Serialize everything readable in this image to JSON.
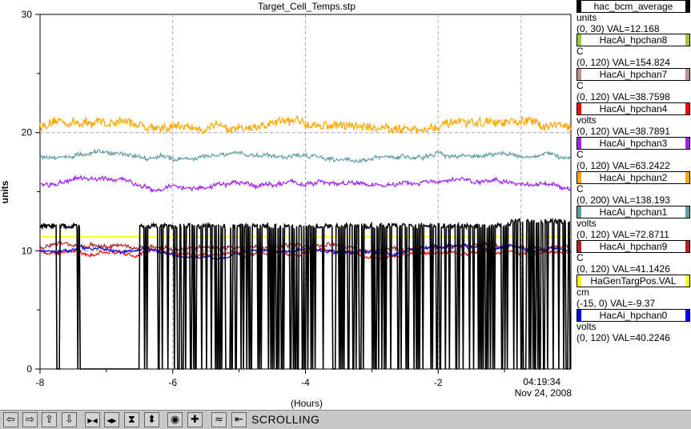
{
  "chart_data": {
    "type": "line",
    "title": "Target_Cell_Temps.stp",
    "xlabel": "(Hours)",
    "ylabel": "units",
    "xlim": [
      -8,
      0
    ],
    "ylim": [
      0,
      30
    ],
    "x_ticks": [
      "-8",
      "-6",
      "-4",
      "-2"
    ],
    "y_ticks": [
      "0",
      "10",
      "20",
      "30"
    ],
    "grid": true,
    "time_label": "04:19:34",
    "date_label": "Nov 24, 2008",
    "series": [
      {
        "name": "HacAi_hpchan2",
        "color": "#ffa500",
        "base": 20.6,
        "noise": 0.35,
        "kind": "noisy"
      },
      {
        "name": "HacAi_hpchan1",
        "color": "#5f9ea0",
        "base": 18.0,
        "noise": 0.15,
        "kind": "noisy"
      },
      {
        "name": "HacAi_hpchan3",
        "color": "#a020f0",
        "base": 15.6,
        "noise": 0.15,
        "kind": "noisy"
      },
      {
        "name": "HaGenTargPos.VAL",
        "color": "#ffff00",
        "base": 11.2,
        "noise": 0.0,
        "kind": "flat"
      },
      {
        "name": "HacAi_hpchan9",
        "color": "#b22222",
        "base": 10.3,
        "noise": 0.15,
        "kind": "noisy"
      },
      {
        "name": "HacAi_hpchan4",
        "color": "#ff0000",
        "base": 9.8,
        "noise": 0.1,
        "kind": "noisy"
      },
      {
        "name": "HacAi_hpchan0",
        "color": "#0000ff",
        "base": 10.0,
        "noise": 0.1,
        "kind": "noisy"
      },
      {
        "name": "hac_bcm_average",
        "color": "#000000",
        "base": 12.1,
        "noise": 0.2,
        "kind": "bcm"
      }
    ]
  },
  "legend": [
    {
      "name": "hac_bcm_average",
      "color": "#000000",
      "unit": "units",
      "value": "(0, 30) VAL=12.168"
    },
    {
      "name": "HacAi_hpchan8",
      "color": "#9acd32",
      "unit": "C",
      "value": "(0, 120) VAL=154.824"
    },
    {
      "name": "HacAi_hpchan7",
      "color": "#bc8f8f",
      "unit": "C",
      "value": "(0, 120) VAL=38.7598"
    },
    {
      "name": "HacAi_hpchan4",
      "color": "#ff0000",
      "unit": "volts",
      "value": "(0, 120) VAL=38.7891"
    },
    {
      "name": "HacAi_hpchan3",
      "color": "#a020f0",
      "unit": "C",
      "value": "(0, 120) VAL=63.2422"
    },
    {
      "name": "HacAi_hpchan2",
      "color": "#ffa500",
      "unit": "C",
      "value": "(0, 200) VAL=138.193"
    },
    {
      "name": "HacAi_hpchan1",
      "color": "#5f9ea0",
      "unit": "volts",
      "value": "(0, 120) VAL=72.8711"
    },
    {
      "name": "HacAi_hpchan9",
      "color": "#b22222",
      "unit": "C",
      "value": "(0, 120) VAL=41.1426"
    },
    {
      "name": "HaGenTargPos.VAL",
      "color": "#ffff00",
      "unit": "cm",
      "value": "(-15, 0) VAL=-9.37"
    },
    {
      "name": "HacAi_hpchan0",
      "color": "#0000ff",
      "unit": "volts",
      "value": "(0, 120) VAL=40.2246"
    }
  ],
  "toolbar": {
    "buttons": [
      {
        "name": "scroll-left-button",
        "glyph": "⇦"
      },
      {
        "name": "scroll-right-button",
        "glyph": "⇨"
      },
      {
        "name": "scroll-up-button",
        "glyph": "⇧"
      },
      {
        "name": "scroll-down-button",
        "glyph": "⇩"
      },
      {
        "name": "zoom-in-x-button",
        "glyph": "▶◀"
      },
      {
        "name": "zoom-out-x-button",
        "glyph": "◀▶"
      },
      {
        "name": "zoom-in-y-button",
        "glyph": "⧗"
      },
      {
        "name": "zoom-out-y-button",
        "glyph": "⬍"
      },
      {
        "name": "stop-button",
        "glyph": "◉"
      },
      {
        "name": "add-button",
        "glyph": "✚"
      },
      {
        "name": "autoscale-button",
        "glyph": "≈"
      },
      {
        "name": "back-to-now-button",
        "glyph": "⇤"
      }
    ],
    "status": "SCROLLING"
  }
}
